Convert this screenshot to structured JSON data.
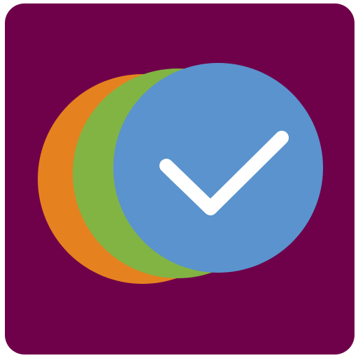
{
  "icon": {
    "name": "app-icon-overlapping-circles-checkmark",
    "colors": {
      "background": "#6F004A",
      "circle_back": "#E6811F",
      "circle_middle": "#82B444",
      "circle_front": "#5A93CE",
      "checkmark": "#FFFFFF"
    }
  }
}
